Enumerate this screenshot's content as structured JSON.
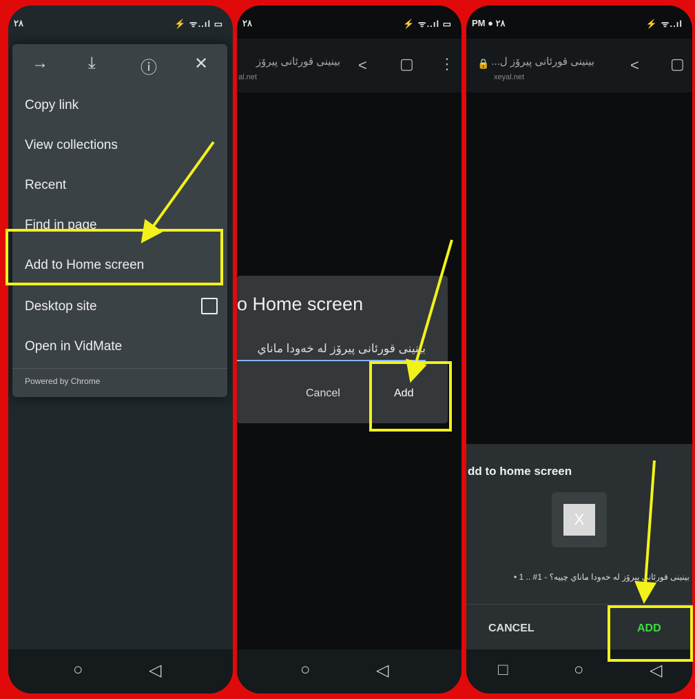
{
  "panel1": {
    "status": {
      "time": "٢٨",
      "icons": "⚡ ᯤ..ıl ▭"
    },
    "toolbar": {
      "forward": "→",
      "download": "⤓",
      "info": "ⓘ",
      "close": "✕"
    },
    "menu_items": [
      "Copy link",
      "View collections",
      "Recent",
      "Find in page",
      "Add to Home screen",
      "Desktop site",
      "Open in VidMate"
    ],
    "powered": "Powered by Chrome"
  },
  "panel2": {
    "status": {
      "time": "٢٨",
      "icons": "⚡ ᯤ..ıl ▭"
    },
    "url_title": "بینینی قورئانی پیرۆز",
    "url_sub": "al.net",
    "dialog_title": "o Home screen",
    "input_value": "بینینی قورئانی پیرۆز لە خەودا ماناي",
    "cancel": "Cancel",
    "add": "Add"
  },
  "panel3": {
    "status": {
      "time": "PM ● ٢٨",
      "icons": "⚡ ᯤ..ıl"
    },
    "url_title": "بینینی قورئانی پیرۆز ل...",
    "url_sub": "xeyal.net",
    "sheet_title": "dd to home screen",
    "icon_letter": "X",
    "app_name": "بینینی قورئانی پیرۆز لە خەودا ماناي چییە؟ - 1# .. 1 •",
    "cancel": "CANCEL",
    "add": "ADD"
  },
  "colors": {
    "highlight": "#f2f21a",
    "frame": "#e00a0a",
    "add_green": "#3ddc3d"
  }
}
